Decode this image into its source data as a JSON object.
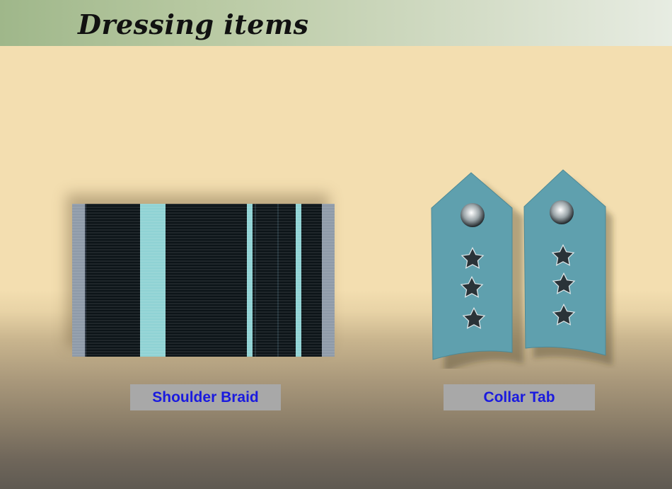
{
  "slide": {
    "title": "Dressing items"
  },
  "items": [
    {
      "caption": "Shoulder Braid",
      "image": "shoulder-braid"
    },
    {
      "caption": "Collar Tab",
      "image": "collar-tab"
    }
  ],
  "colors": {
    "braid_dark": "#0c1418",
    "braid_light": "#8fd2d4",
    "braid_edge": "#8e9aa8",
    "collar_tab": "#5fa0ae",
    "caption_bg": "#a8a8a8",
    "caption_text": "#1a1adf"
  }
}
